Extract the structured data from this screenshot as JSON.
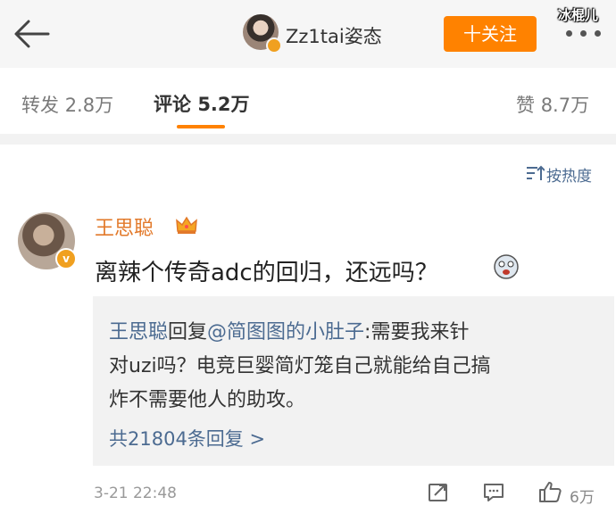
{
  "header": {
    "title": "Zz1tai姿态",
    "follow_label": "十关注",
    "watermark": "冰棍儿"
  },
  "tabs": {
    "repost_label": "转发",
    "repost_count": "2.8万",
    "comment_label": "评论",
    "comment_count": "5.2万",
    "like_label": "赞",
    "like_count": "8.7万"
  },
  "sort": {
    "label": "按热度"
  },
  "comment": {
    "username": "王思聪",
    "text": "离辣个传奇adc的回归，还远吗？",
    "reply": {
      "author": "王思聪",
      "verb": "回复",
      "mention": "@简图图的小肚子",
      "line1_rest": ":需要我来针",
      "line2": "对uzi吗？电竞巨婴简灯笼自己就能给自己搞",
      "line3": "炸不需要他人的助攻。",
      "more": "共21804条回复 >"
    },
    "timestamp": "3-21 22:48",
    "like_count": "6万"
  },
  "icons": {
    "back": "back-arrow-icon",
    "more": "more-dots-icon",
    "sort": "sort-icon",
    "crown": "crown-icon",
    "emoji": "emoji-icon",
    "share": "share-icon",
    "reply": "reply-icon",
    "like": "thumbs-up-icon"
  },
  "colors": {
    "accent": "#ff8200",
    "username": "#e2792a",
    "link": "#4c6b91"
  }
}
